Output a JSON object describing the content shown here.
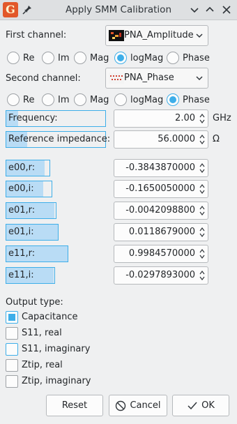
{
  "window": {
    "title": "Apply SMM Calibration"
  },
  "first_channel": {
    "label": "First channel:",
    "combo_value": "PNA_Amplitude",
    "options": [
      "Re",
      "Im",
      "Mag",
      "logMag",
      "Phase"
    ],
    "selected": "logMag"
  },
  "second_channel": {
    "label": "Second channel:",
    "combo_value": "PNA_Phase",
    "options": [
      "Re",
      "Im",
      "Mag",
      "logMag",
      "Phase"
    ],
    "selected": "Phase"
  },
  "frequency": {
    "label": "Frequency:",
    "value": "2.00",
    "unit": "GHz",
    "fill": 0.12
  },
  "impedance": {
    "label": "Reference impedance:",
    "value": "56.0000",
    "unit": "Ω",
    "fill": 0.21
  },
  "coefficients": [
    {
      "label": "e00,r:",
      "value": "-0.3843870000",
      "fill": 0.88
    },
    {
      "label": "e00,i:",
      "value": "-0.1650050000",
      "fill": 0.81
    },
    {
      "label": "e01,r:",
      "value": "-0.0042098800",
      "fill": 0.97
    },
    {
      "label": "e01,i:",
      "value": "0.0118679000",
      "fill": 1.0
    },
    {
      "label": "e11,r:",
      "value": "0.9984570000",
      "fill": 1.0
    },
    {
      "label": "e11,i:",
      "value": "-0.0297893000",
      "fill": 0.98
    }
  ],
  "output": {
    "label": "Output type:",
    "options": [
      {
        "label": "Capacitance",
        "checked": true
      },
      {
        "label": "S11, real",
        "checked": false
      },
      {
        "label": "S11, imaginary",
        "checked": false
      },
      {
        "label": "Ztip, real",
        "checked": false
      },
      {
        "label": "Ztip, imaginary",
        "checked": false
      }
    ]
  },
  "buttons": {
    "reset": "Reset",
    "cancel": "Cancel",
    "ok": "OK"
  },
  "colors": {
    "accent": "#3daee9",
    "fill": "#b9dcf5",
    "window_bg": "#eff0f1"
  }
}
